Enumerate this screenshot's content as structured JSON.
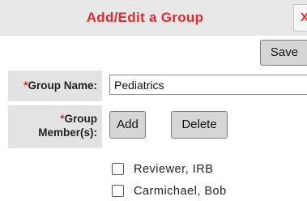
{
  "dialog": {
    "title": "Add/Edit a Group",
    "close_label": "X"
  },
  "toolbar": {
    "save_label": "Save"
  },
  "form": {
    "group_name": {
      "required_marker": "*",
      "label": "Group Name:",
      "value": "Pediatrics"
    },
    "group_members": {
      "required_marker": "*",
      "label_line1": "Group",
      "label_line2": "Member(s):",
      "add_label": "Add",
      "delete_label": "Delete",
      "members": [
        {
          "name": "Reviewer, IRB",
          "checked": false
        },
        {
          "name": "Carmichael, Bob",
          "checked": false
        }
      ]
    }
  }
}
